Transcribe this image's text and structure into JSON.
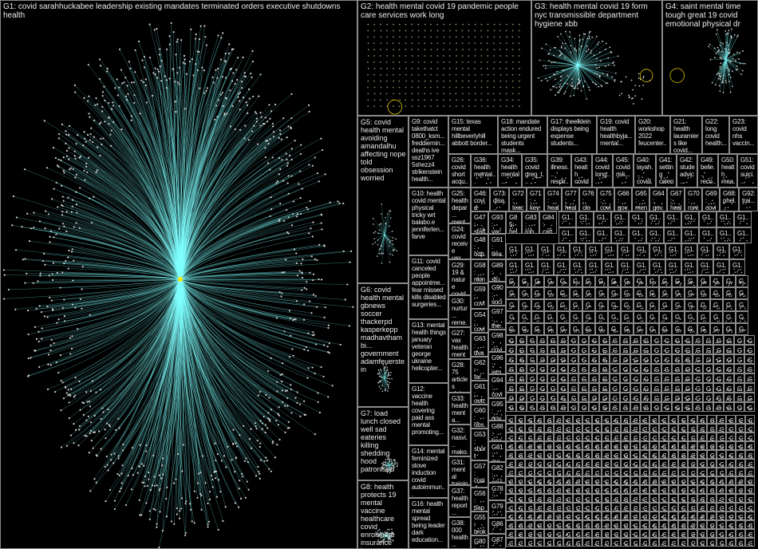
{
  "colors": {
    "background": "#000000",
    "edge": "#7fffff",
    "node": "#cfcfcf",
    "border": "#8a8a8a",
    "label": "#ececec",
    "hub": "#ffe600"
  },
  "groups": [
    {
      "id": "G1",
      "label": "G1: covid sarahhuckabee leadership existing mandates terminated orders executive shutdowns health"
    },
    {
      "id": "G2",
      "label": "G2: health mental covid 19 pandemic people care services work long"
    },
    {
      "id": "G3",
      "label": "G3: health mental covid 19 form nyc transmissible department hygiene xbb"
    },
    {
      "id": "G4",
      "label": "G4: saint mental time tough great 19 covid emotional physical dr"
    },
    {
      "id": "G5",
      "label": "G5: covid health mental avoiding amandalhu affecting nope told obsession worried"
    },
    {
      "id": "G6",
      "label": "G6: covid health mental gbnews soccer thackerpd kasperkepp madhavthambi... government adamfeuerstein"
    },
    {
      "id": "G7",
      "label": "G7: load lunch closed well sad eateries killing shedding hood patronised"
    },
    {
      "id": "G8",
      "label": "G8: health protects 19 mental vaccine healthcare covid enrollment insurance january"
    },
    {
      "id": "G9",
      "label": "G9: covid takethatct 0800_ksm... freddiemin... deaths ive ssz1967 5shezz4 strikenstein health..."
    },
    {
      "id": "G10",
      "label": "G10: health covid mental physical tricky wrt balabo.e jenniferlen... farve"
    },
    {
      "id": "G11",
      "label": "G11: covid canceled people appointme... fear missed kills disabled surgeries..."
    },
    {
      "id": "G12",
      "label": "G12: vaccine health covering paid ass mental promoting..."
    },
    {
      "id": "G13",
      "label": "G13: mental health things january veteran george ukraine helicopter..."
    },
    {
      "id": "G14",
      "label": "G14: mental feminized stove induction covid autoimmun..."
    },
    {
      "id": "G15",
      "label": "G15: texas mental hillbeverlyhill abbott border..."
    },
    {
      "id": "G16",
      "label": "G16: health mental spread being leader dark education..."
    },
    {
      "id": "G17",
      "label": "G17: theelklein displays being expense students..."
    },
    {
      "id": "G18",
      "label": "G18: mandate action endured being urgent students mask..."
    },
    {
      "id": "G19",
      "label": "G19: covid health healthbyja... mental..."
    },
    {
      "id": "G20",
      "label": "G20: workshop 2022 feucenter..."
    },
    {
      "id": "G21",
      "label": "G21: health lauramiers like covid..."
    },
    {
      "id": "G22",
      "label": "G22: long covid health..."
    },
    {
      "id": "G23",
      "label": "G23: covid nhs vaccin..."
    },
    {
      "id": "G24",
      "label": "G24: covid receive vax..."
    },
    {
      "id": "G25",
      "label": "G25: health depar... mental..."
    },
    {
      "id": "G26",
      "label": "G26: covid short acqu..."
    },
    {
      "id": "G27",
      "label": "G27: vax health menta..."
    },
    {
      "id": "G28",
      "label": "G28: 75 articles claim..."
    },
    {
      "id": "G29",
      "label": "G29: 19 & nature covid..."
    },
    {
      "id": "G30",
      "label": "G30: nurtur... reme... social..."
    },
    {
      "id": "G31",
      "label": "G31: mental trainin..."
    },
    {
      "id": "G32",
      "label": "G32: nasvi... mako..."
    },
    {
      "id": "G33",
      "label": "G33: health menta..."
    },
    {
      "id": "G34",
      "label": "G34: health mental..."
    },
    {
      "id": "G35",
      "label": "G35: covid greg_t..."
    },
    {
      "id": "G36",
      "label": "G36: health mental..."
    },
    {
      "id": "G37",
      "label": "G37: health report..."
    },
    {
      "id": "G38",
      "label": "G38: 000 health..."
    },
    {
      "id": "G39",
      "label": "G39: illness... respir..."
    },
    {
      "id": "G40",
      "label": "G40: layah... covid..."
    },
    {
      "id": "G41",
      "label": "G41: setting calen..."
    },
    {
      "id": "G42",
      "label": "G42: stude advic..."
    },
    {
      "id": "G43",
      "label": "G43: health covid..."
    },
    {
      "id": "G44",
      "label": "G44: covid long..."
    },
    {
      "id": "G45",
      "label": "G45: covid risk..."
    },
    {
      "id": "G46",
      "label": "G46: covid men..."
    },
    {
      "id": "G47",
      "label": "G47: staff hos..."
    },
    {
      "id": "G48",
      "label": "G48: odp... vpra..."
    },
    {
      "id": "G49",
      "label": "G49: belie... reco..."
    },
    {
      "id": "G50",
      "label": "G50: health mea..."
    },
    {
      "id": "G51",
      "label": "G51: covid suici..."
    },
    {
      "id": "G52",
      "label": "G52: covid men..."
    },
    {
      "id": "G53",
      "label": "G53: short aca..."
    },
    {
      "id": "G54",
      "label": "G54: covi..."
    },
    {
      "id": "G55",
      "label": "G55: broke covi..."
    },
    {
      "id": "G56",
      "label": "G56: paper men..."
    },
    {
      "id": "G57",
      "label": "G57: covid timr..."
    },
    {
      "id": "G58",
      "label": "G58: nkin..."
    },
    {
      "id": "G59",
      "label": "G59: covid men..."
    },
    {
      "id": "G60",
      "label": "G60: obs..."
    },
    {
      "id": "G61",
      "label": "G61: outc..."
    },
    {
      "id": "G62",
      "label": "G62: far..."
    },
    {
      "id": "G63",
      "label": "G63: dvaw toro..."
    },
    {
      "id": "G64",
      "label": "G64: gov..."
    },
    {
      "id": "G65",
      "label": "G65: men..."
    },
    {
      "id": "G66",
      "label": "G66: gov..."
    },
    {
      "id": "G67",
      "label": "G67: heal..."
    },
    {
      "id": "G68",
      "label": "G68: phel..."
    },
    {
      "id": "G69",
      "label": "G69: covi..."
    },
    {
      "id": "G70",
      "label": "G70: roni..."
    },
    {
      "id": "G71",
      "label": "G71: key..."
    },
    {
      "id": "G72",
      "label": "G72: teac..."
    },
    {
      "id": "G73",
      "label": "G73: disa..."
    },
    {
      "id": "G74",
      "label": "G74: heal..."
    },
    {
      "id": "G75",
      "label": "G75: covi..."
    },
    {
      "id": "G76",
      "label": "G76: clow..."
    },
    {
      "id": "G77",
      "label": "G77: heal..."
    },
    {
      "id": "G78",
      "label": "G78: drer..."
    },
    {
      "id": "G79",
      "label": "G79: me..."
    },
    {
      "id": "G80",
      "label": "G80: cov..."
    },
    {
      "id": "G81",
      "label": "G81: me..."
    },
    {
      "id": "G82",
      "label": "G82: covi..."
    },
    {
      "id": "G83",
      "label": "G83: rob..."
    },
    {
      "id": "G84",
      "label": "G84: catt..."
    },
    {
      "id": "G85",
      "label": "G85: hel..."
    },
    {
      "id": "G86",
      "label": "G86: neu..."
    },
    {
      "id": "G87",
      "label": "G87: strik..."
    },
    {
      "id": "G88",
      "label": "G88: hea..."
    },
    {
      "id": "G89",
      "label": "G89: stu..."
    },
    {
      "id": "G90",
      "label": "G90: soci..."
    },
    {
      "id": "G91",
      "label": "G91: hea..."
    },
    {
      "id": "G92",
      "label": "G92: trai..."
    },
    {
      "id": "G93",
      "label": "G93: vac..."
    },
    {
      "id": "G94",
      "label": "G94: covi..."
    },
    {
      "id": "G95",
      "label": "G95: gov..."
    },
    {
      "id": "G96",
      "label": "G96: jam..."
    },
    {
      "id": "G97",
      "label": "G97: the..."
    },
    {
      "id": "G98",
      "label": "G98: covi..."
    }
  ],
  "grid_labels": [
    "G1..",
    "G..",
    "G.",
    "G"
  ]
}
